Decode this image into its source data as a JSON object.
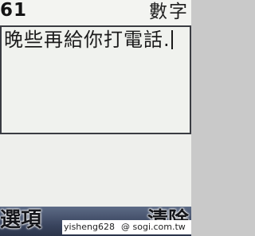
{
  "status_bar": {
    "char_count": "61",
    "input_mode": "數字"
  },
  "editor": {
    "text": "晚些再給你打電話."
  },
  "softkeys": {
    "left_label": "選項",
    "right_label": "清除"
  },
  "watermark": {
    "user": "yisheng628",
    "site": "@ sogi.com.tw"
  }
}
